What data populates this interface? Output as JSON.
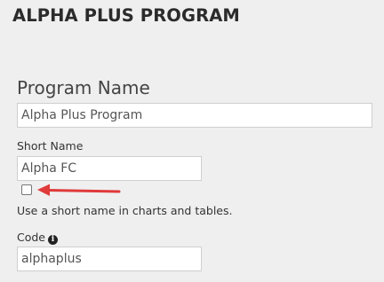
{
  "header": {
    "title": "ALPHA PLUS PROGRAM"
  },
  "program_section": {
    "label": "Program Name",
    "value": "Alpha Plus Program"
  },
  "short_name": {
    "label": "Short Name",
    "value": "Alpha FC",
    "checkbox_checked": false,
    "checkbox_help": "Use a short name in charts and tables."
  },
  "code": {
    "label": "Code",
    "info_icon": "info-circle-icon",
    "info_glyph": "i",
    "value": "alphaplus"
  },
  "annotation": {
    "arrow_color": "#e03a3a"
  },
  "colors": {
    "background": "#efefef",
    "input_border": "#cfcfcf"
  }
}
